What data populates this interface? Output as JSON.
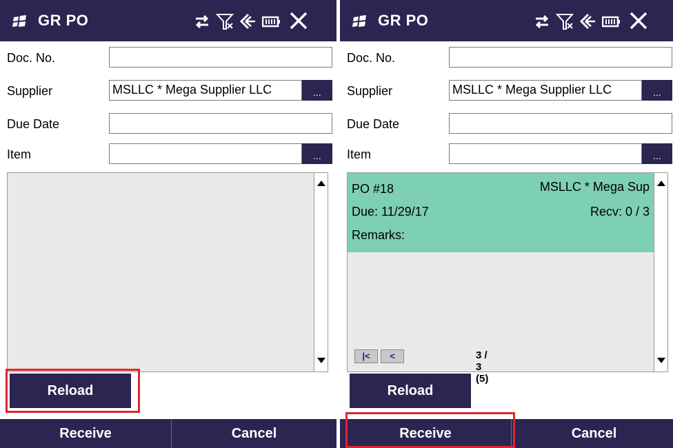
{
  "left": {
    "title": "GR PO",
    "fields": {
      "doc_no": {
        "label": "Doc. No.",
        "value": ""
      },
      "supplier": {
        "label": "Supplier",
        "value": "MSLLC * Mega Supplier LLC"
      },
      "due_date": {
        "label": "Due Date",
        "value": ""
      },
      "item": {
        "label": "Item",
        "value": ""
      }
    },
    "browse_label": "...",
    "buttons": {
      "reload": "Reload",
      "receive": "Receive",
      "cancel": "Cancel"
    }
  },
  "right": {
    "title": "GR PO",
    "fields": {
      "doc_no": {
        "label": "Doc. No.",
        "value": ""
      },
      "supplier": {
        "label": "Supplier",
        "value": "MSLLC * Mega Supplier LLC"
      },
      "due_date": {
        "label": "Due Date",
        "value": ""
      },
      "item": {
        "label": "Item",
        "value": ""
      }
    },
    "browse_label": "...",
    "record": {
      "po": "PO #18",
      "supplier": "MSLLC * Mega Sup",
      "due": "Due: 11/29/17",
      "recv": "Recv: 0 / 3",
      "remarks": "Remarks:"
    },
    "pager": {
      "first": "|<",
      "prev": "<",
      "status": "3 / 3 (5)"
    },
    "buttons": {
      "reload": "Reload",
      "receive": "Receive",
      "cancel": "Cancel"
    }
  },
  "colors": {
    "bar": "#2a2551",
    "record_bg": "#7dd0b1",
    "highlight": "#e0242d"
  },
  "icons": [
    "windows-logo-icon",
    "sync-arrows-icon",
    "no-signal-icon",
    "volume-muted-icon",
    "battery-icon",
    "close-icon"
  ]
}
